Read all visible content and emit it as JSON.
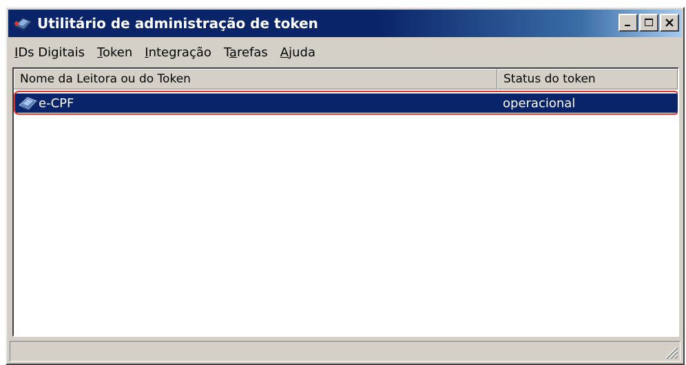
{
  "window": {
    "title": "Utilitário de administração de token",
    "title_icon": "token-reader-icon",
    "buttons": {
      "minimize": "_",
      "maximize": "□",
      "close": "×"
    }
  },
  "menu": {
    "items": [
      {
        "pre": "",
        "key": "I",
        "post": "Ds Digitais"
      },
      {
        "pre": "",
        "key": "T",
        "post": "oken"
      },
      {
        "pre": "",
        "key": "I",
        "post": "ntegração"
      },
      {
        "pre": "T",
        "key": "a",
        "post": "refas"
      },
      {
        "pre": "",
        "key": "A",
        "post": "juda"
      }
    ]
  },
  "list": {
    "columns": [
      "Nome da Leitora ou do Token",
      "Status do token"
    ],
    "rows": [
      {
        "name": "e-CPF",
        "status": "operacional",
        "icon": "token-reader-icon",
        "selected": true
      }
    ]
  },
  "colors": {
    "titlebar": "#0a246a",
    "selection": "#0a246a",
    "highlight_outline": "#e0302a",
    "face": "#d4d0c8"
  }
}
